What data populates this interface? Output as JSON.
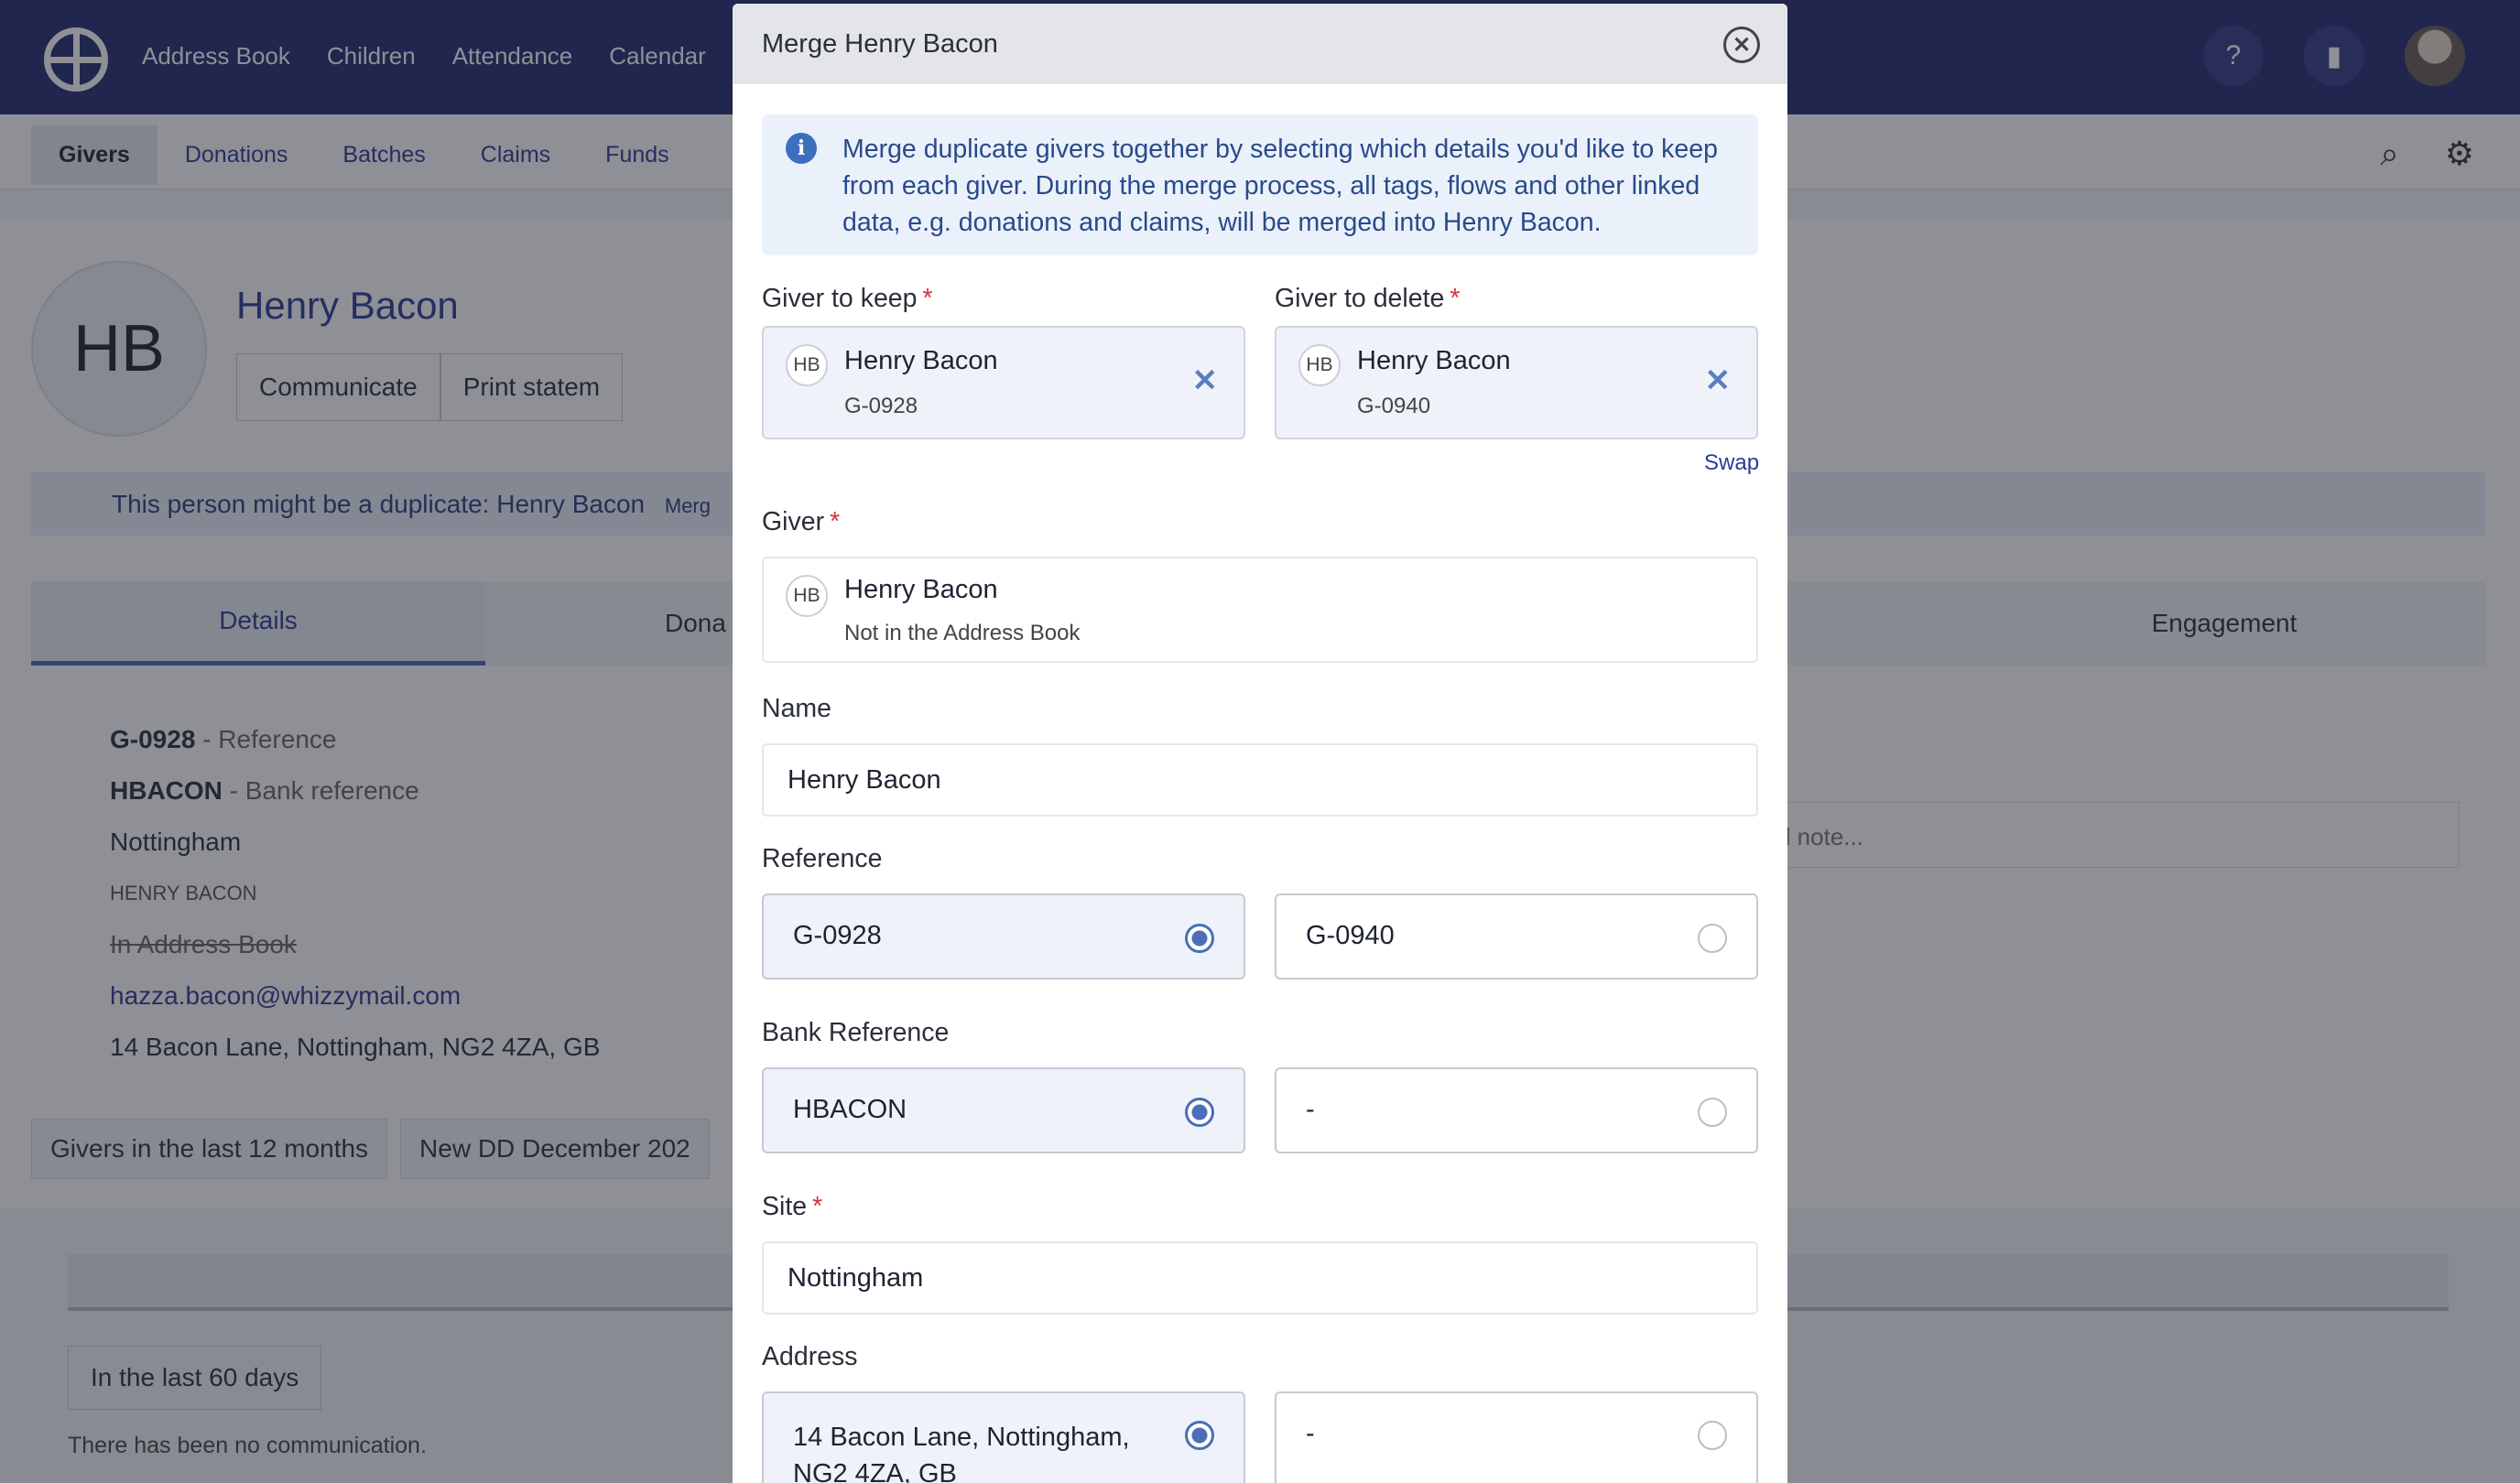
{
  "background": {
    "top_nav": [
      "Address Book",
      "Children",
      "Attendance",
      "Calendar"
    ],
    "sub_nav": [
      "Givers",
      "Donations",
      "Batches",
      "Claims",
      "Funds"
    ],
    "avatar_initials": "HB",
    "name": "Henry Bacon",
    "communicate_label": "Communicate",
    "print_label": "Print statem",
    "duplicate_notice": "This person might be a duplicate: Henry Bacon",
    "duplicate_merge_link": "Merg",
    "tabs": {
      "details": "Details",
      "donations": "Dona",
      "engagement": "Engagement"
    },
    "details": {
      "reference": "G-0928",
      "reference_label": " - Reference",
      "bank_reference": "HBACON",
      "bank_reference_label": " - Bank reference",
      "site": "Nottingham",
      "contact_heading": "HENRY BACON",
      "address_book_status": "In Address Book",
      "email": "hazza.bacon@whizzymail.com",
      "address": "14 Bacon Lane, Nottingham, NG2 4ZA, GB"
    },
    "pills": [
      "Givers in the last 12 months",
      "New DD December 202"
    ],
    "note_placeholder": "d note...",
    "filter_label": "In the last 60 days",
    "empty_message": "There has been no communication."
  },
  "modal": {
    "title": "Merge Henry Bacon",
    "info_text": "Merge duplicate givers together by selecting which details you'd like to keep from each giver. During the merge process, all tags, flows and other linked data, e.g. donations and claims, will be merged into Henry Bacon.",
    "giver_to_keep": {
      "label": "Giver to keep",
      "initials": "HB",
      "name": "Henry Bacon",
      "reference": "G-0928"
    },
    "giver_to_delete": {
      "label": "Giver to delete",
      "initials": "HB",
      "name": "Henry Bacon",
      "reference": "G-0940"
    },
    "swap_label": "Swap",
    "giver": {
      "label": "Giver",
      "initials": "HB",
      "name": "Henry Bacon",
      "status": "Not in the Address Book"
    },
    "name": {
      "label": "Name",
      "value": "Henry Bacon"
    },
    "reference": {
      "label": "Reference",
      "option_a": "G-0928",
      "option_b": "G-0940",
      "selected": "a"
    },
    "bank_reference": {
      "label": "Bank Reference",
      "option_a": "HBACON",
      "option_b": "-",
      "selected": "a"
    },
    "site": {
      "label": "Site",
      "value": "Nottingham"
    },
    "address": {
      "label": "Address",
      "option_a_line1": "14 Bacon Lane, Nottingham,",
      "option_a_line2": "NG2 4ZA, GB",
      "option_b": "-",
      "selected": "a"
    },
    "required_mark": "*"
  },
  "colors": {
    "nav": "#222a6e",
    "accent": "#4a6fb8",
    "required": "#d2343b",
    "info_bg": "#eaf1fa"
  }
}
